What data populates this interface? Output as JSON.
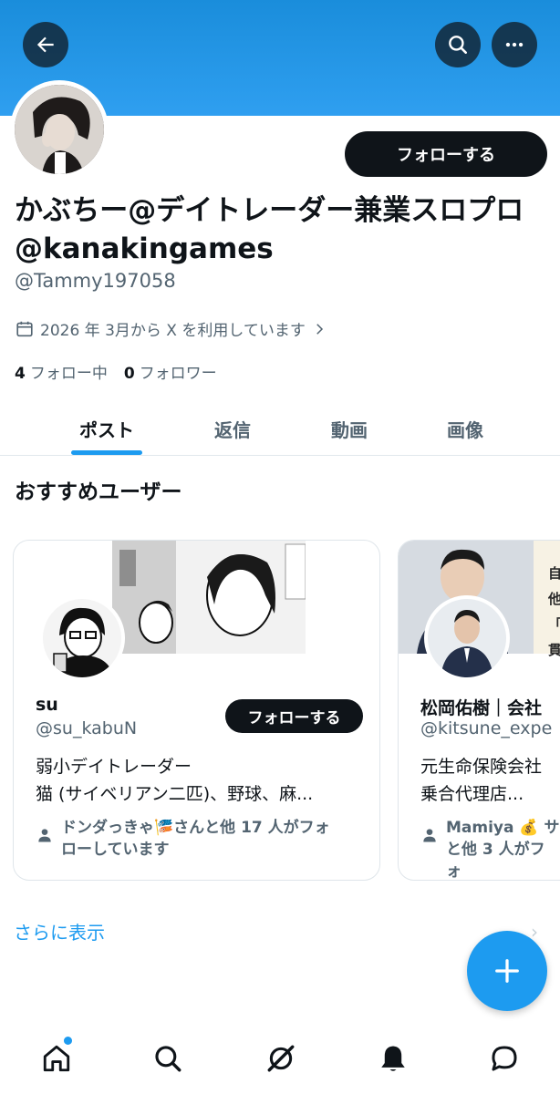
{
  "header": {
    "icons": [
      "back-arrow-icon",
      "search-icon",
      "more-icon"
    ]
  },
  "profile": {
    "display_name": "かぶちー@デイトレーダー兼業スロプロ@kanakingames",
    "handle": "@Tammy197058",
    "joined": "2026 年 3月から X を利用しています",
    "following_count": "4",
    "following_label": "フォロー中",
    "followers_count": "0",
    "followers_label": "フォロワー",
    "follow_button": "フォローする"
  },
  "tabs": [
    {
      "label": "ポスト",
      "active": true
    },
    {
      "label": "返信",
      "active": false
    },
    {
      "label": "動画",
      "active": false
    },
    {
      "label": "画像",
      "active": false
    }
  ],
  "recommendations": {
    "title": "おすすめユーザー",
    "cards": [
      {
        "name": "su",
        "handle": "@su_kabuN",
        "bio_line1": "弱小デイトレーダー",
        "bio_line2": "猫 (サイベリアン二匹)、野球、麻...",
        "social_line1": "ドンダっきゃ🎏さんと他 17 人がフォ",
        "social_line2": "ローしています",
        "follow_button": "フォローする"
      },
      {
        "name": "松岡佑樹｜会社",
        "handle": "@kitsune_expe",
        "bio_line1": "元生命保険会社",
        "bio_line2": "乗合代理店...",
        "social_line1": "Mamiya 💰 サ",
        "social_line2": "と他 3 人がフォ",
        "banner_text": "自 他 「 貫"
      }
    ],
    "more_label": "さらに表示"
  },
  "bottom_nav": [
    "home-icon",
    "search-icon",
    "grok-icon",
    "notifications-icon",
    "messages-icon"
  ],
  "colors": {
    "accent": "#1d9bf0",
    "banner": "#1a8ddb",
    "text": "#0f1419",
    "muted": "#536471"
  }
}
